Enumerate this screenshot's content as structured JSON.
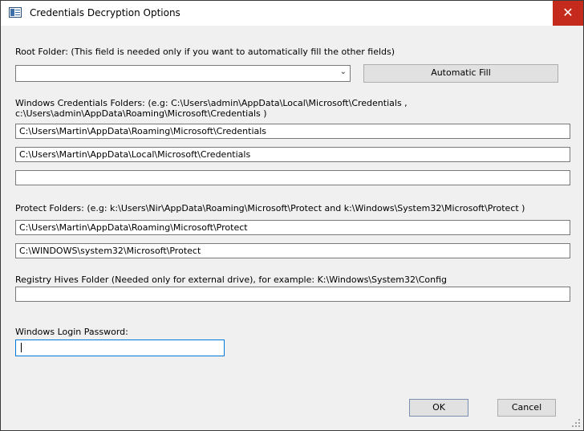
{
  "window": {
    "title": "Credentials Decryption Options",
    "close_glyph": "✕"
  },
  "root_folder": {
    "label": "Root Folder: (This field is needed only if you want to automatically fill the other fields)",
    "value": "",
    "auto_fill_label": "Automatic Fill"
  },
  "credentials": {
    "label_line1": "Windows Credentials Folders:  (e.g: C:\\Users\\admin\\AppData\\Local\\Microsoft\\Credentials ,",
    "label_line2": "c:\\Users\\admin\\AppData\\Roaming\\Microsoft\\Credentials )",
    "fields": [
      "C:\\Users\\Martin\\AppData\\Roaming\\Microsoft\\Credentials",
      "C:\\Users\\Martin\\AppData\\Local\\Microsoft\\Credentials",
      ""
    ]
  },
  "protect": {
    "label": "Protect Folders: (e.g: k:\\Users\\Nir\\AppData\\Roaming\\Microsoft\\Protect and k:\\Windows\\System32\\Microsoft\\Protect )",
    "fields": [
      "C:\\Users\\Martin\\AppData\\Roaming\\Microsoft\\Protect",
      "C:\\WINDOWS\\system32\\Microsoft\\Protect"
    ]
  },
  "registry": {
    "label": "Registry Hives Folder (Needed only for external drive), for example:  K:\\Windows\\System32\\Config",
    "value": ""
  },
  "password": {
    "label": "Windows Login Password:",
    "value": ""
  },
  "buttons": {
    "ok": "OK",
    "cancel": "Cancel"
  }
}
